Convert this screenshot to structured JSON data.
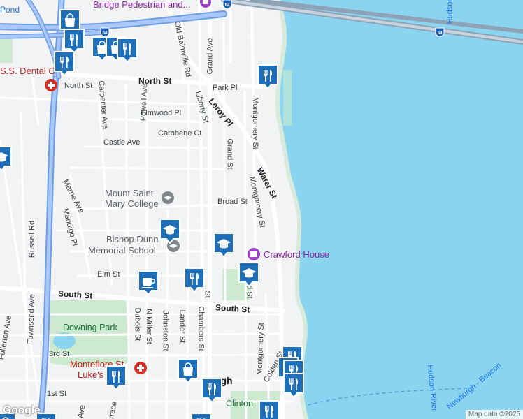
{
  "map": {
    "colors": {
      "land": "#f1f3f4",
      "water": "#8ad4f0",
      "park": "#cde9cf",
      "road": "#ffffff",
      "highway": "#8ab4f8",
      "marker_fill": "#1e6fb8"
    },
    "streets": {
      "north_st": "North St",
      "north_st_left": "North St",
      "south_st": "South St",
      "south_st_left": "South St",
      "leroy_pl": "Leroy Pl",
      "water_st": "Water St",
      "grand_ave": "Grand Ave",
      "old_balmville_rd": "Old Balmville Rd",
      "liberty_st": "Liberty St",
      "park_pl": "Park Pl",
      "montgomery_st_1": "Montgomery St",
      "montgomery_st_2": "Montgomery St",
      "montgomery_st_3": "Montgomery St",
      "elmwood_pl": "Elmwood Pl",
      "carobene_ct": "Carobene Ct",
      "castle_ave": "Castle Ave",
      "grand_st_1": "Grand St",
      "grand_st_2": "Grand St",
      "broad_st": "Broad St",
      "carpenter_ave": "Carpenter Ave",
      "powell_ave": "Powell Ave",
      "marne_ave": "Marne Ave",
      "mandigo_pl": "Mandigo Pl",
      "russell_rd": "Russell Rd",
      "elm_st": "Elm St",
      "townsend_ave": "Townsend Ave",
      "dubois_st": "Dubois St",
      "n_miller_st": "N Miller St",
      "johnston_st": "Johnston St",
      "lander_st": "Lander St",
      "chambers_st": "Chambers St",
      "colden_st": "Colden St",
      "third_st": "3rd St",
      "first_st": "1st St",
      "fullerton": "Fullerton Ave",
      "st_partial": "St",
      "ave_partial": "Ave",
      "errace_partial": "errace"
    },
    "pois": {
      "bridge": "Bridge Pedestrian and...",
      "dental": "S.S. Dental C",
      "msmc_line1": "Mount Saint",
      "msmc_line2": "Mary College",
      "bishop_line1": "Bishop Dunn",
      "bishop_line2": "Memorial School",
      "crawford": "Crawford House",
      "downing_park": "Downing Park",
      "montefiore_line1": "Montefiore St",
      "montefiore_line2": "Luke's Co",
      "newburgh": "rgh",
      "clinton": "Clinton",
      "pond": "Pond",
      "hudson_top": "Hudson",
      "hudson_river": "Hudson River",
      "newburgh_beacon": "Newburgh - Beacon"
    },
    "shields": {
      "i84": "84"
    },
    "google_logo": "Google",
    "attribution": "Map data ©2025"
  },
  "markers": [
    {
      "icon": "shopping-bag-icon"
    },
    {
      "icon": "restaurant-icon"
    },
    {
      "icon": "shopping-bag-icon"
    },
    {
      "icon": "shopping-bag-icon"
    },
    {
      "icon": "restaurant-icon"
    },
    {
      "icon": "restaurant-icon"
    },
    {
      "icon": "restaurant-icon"
    },
    {
      "icon": "school-icon"
    },
    {
      "icon": "school-icon"
    },
    {
      "icon": "school-icon"
    },
    {
      "icon": "school-icon"
    },
    {
      "icon": "cafe-icon"
    },
    {
      "icon": "restaurant-icon"
    },
    {
      "icon": "shopping-bag-icon"
    },
    {
      "icon": "restaurant-icon"
    },
    {
      "icon": "restaurant-icon"
    },
    {
      "icon": "restaurant-icon"
    },
    {
      "icon": "restaurant-icon"
    },
    {
      "icon": "restaurant-icon"
    },
    {
      "icon": "restaurant-icon"
    },
    {
      "icon": "restaurant-icon"
    },
    {
      "icon": "restaurant-icon"
    },
    {
      "icon": "restaurant-icon"
    },
    {
      "icon": "shopping-bag-icon"
    }
  ]
}
